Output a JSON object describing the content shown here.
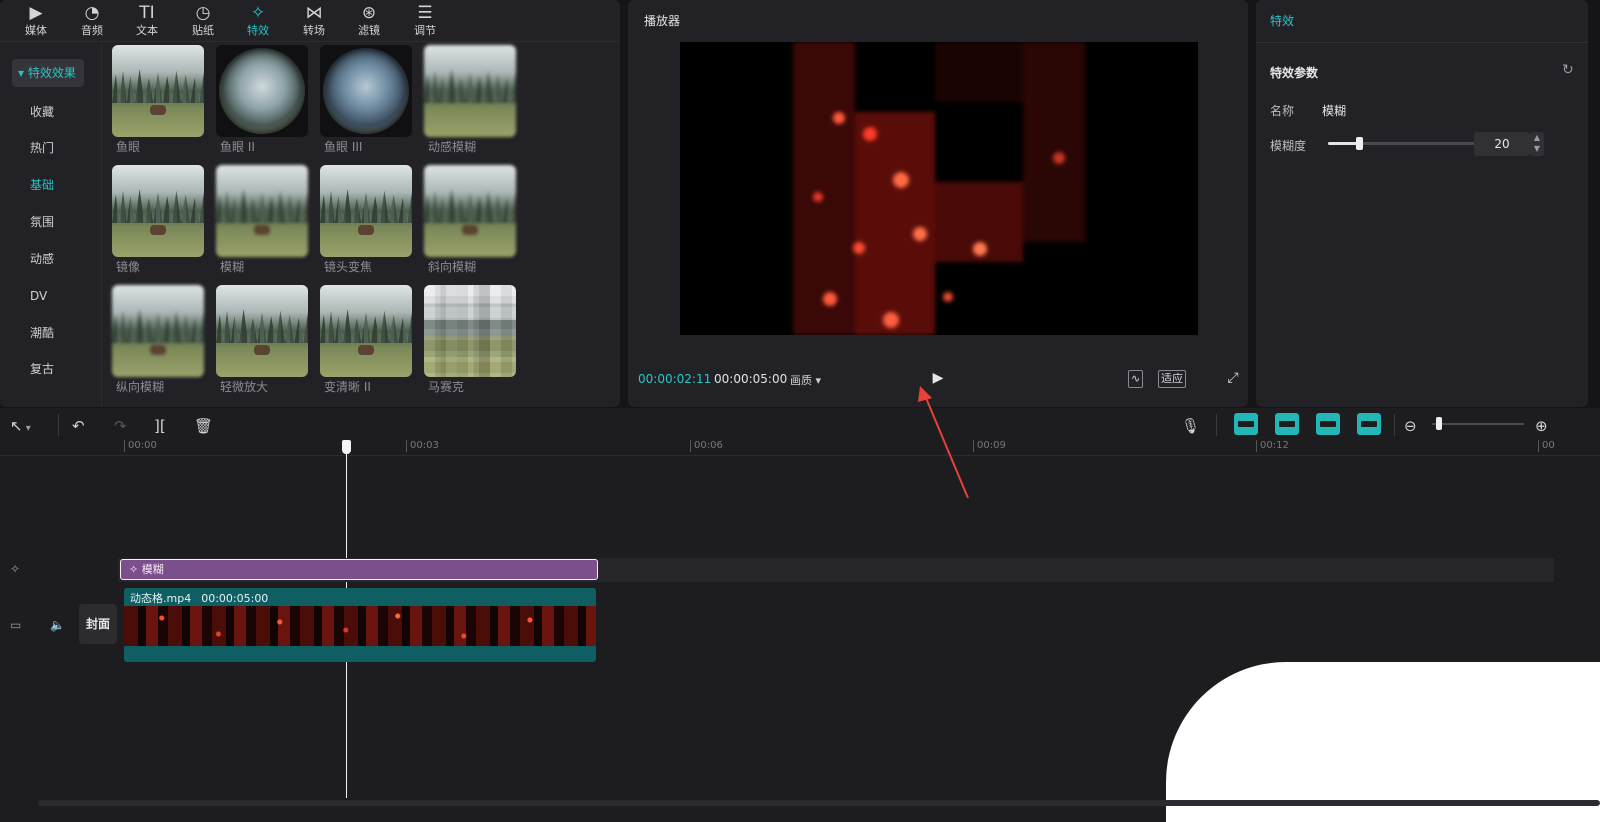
{
  "top_tabs": [
    {
      "label": "媒体",
      "icon": "media-icon"
    },
    {
      "label": "音频",
      "icon": "audio-icon"
    },
    {
      "label": "文本",
      "icon": "text-icon"
    },
    {
      "label": "贴纸",
      "icon": "sticker-icon"
    },
    {
      "label": "特效",
      "icon": "effects-icon",
      "active": true
    },
    {
      "label": "转场",
      "icon": "transition-icon"
    },
    {
      "label": "滤镜",
      "icon": "filter-icon"
    },
    {
      "label": "调节",
      "icon": "adjust-icon"
    }
  ],
  "categories": {
    "header": "特效效果",
    "items": [
      "收藏",
      "热门",
      "基础",
      "氛围",
      "动感",
      "DV",
      "潮酷",
      "复古"
    ],
    "selected": "基础"
  },
  "effects": [
    {
      "label": "鱼眼"
    },
    {
      "label": "鱼眼 II"
    },
    {
      "label": "鱼眼 III"
    },
    {
      "label": "动感模糊"
    },
    {
      "label": "镜像"
    },
    {
      "label": "模糊"
    },
    {
      "label": "镜头变焦"
    },
    {
      "label": "斜向模糊"
    },
    {
      "label": "纵向模糊"
    },
    {
      "label": "轻微放大"
    },
    {
      "label": "变清晰 II"
    },
    {
      "label": "马赛克"
    }
  ],
  "player": {
    "title": "播放器",
    "current_time": "00:00:02:11",
    "total_time": "00:00:05:00",
    "quality_label": "画质",
    "fit_label": "适应"
  },
  "effect_panel": {
    "title": "特效",
    "section": "特效参数",
    "name_label": "名称",
    "name_value": "模糊",
    "blur_label": "模糊度",
    "blur_value": "20",
    "blur_fraction": 0.2
  },
  "timeline": {
    "ruler": [
      "00:00",
      "00:03",
      "00:06",
      "00:09",
      "00:12",
      "00"
    ],
    "effect_clip": "模糊",
    "video_clip_name": "动态格.mp4",
    "video_clip_duration": "00:00:05:00",
    "cover_label": "封面",
    "zoom_fraction": 0.04
  },
  "colors": {
    "accent": "#25c6c6",
    "effect_clip": "#7a4f8c",
    "video_clip": "#0f5e63",
    "annotation_arrow": "#e8413a"
  }
}
